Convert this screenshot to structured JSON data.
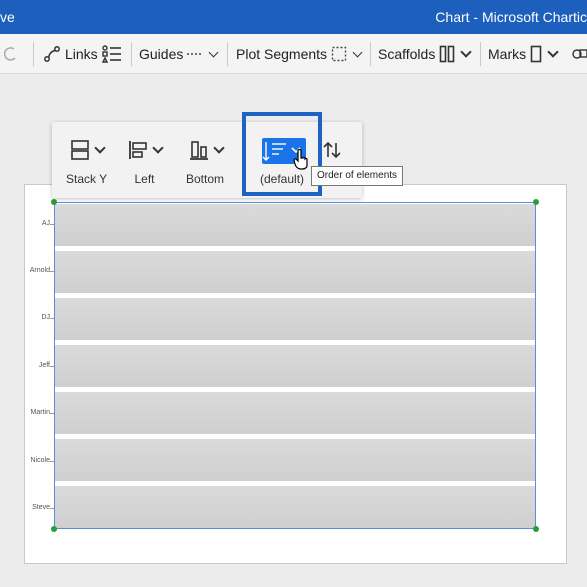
{
  "window": {
    "left_fragment": "ve",
    "title": "Chart - Microsoft Chartic"
  },
  "toolbar": {
    "links_label": "Links",
    "guides_label": "Guides",
    "plot_segments_label": "Plot Segments",
    "scaffolds_label": "Scaffolds",
    "marks_label": "Marks"
  },
  "panel": {
    "stack_label": "Stack Y",
    "align_x_label": "Left",
    "align_y_label": "Bottom",
    "order_label": "(default)"
  },
  "tooltip": {
    "text": "Order of elements"
  },
  "chart": {
    "categories": [
      "AJ",
      "Arnold",
      "DJ",
      "Jeff",
      "Martin",
      "Nicole",
      "Steve"
    ]
  },
  "colors": {
    "accent": "#1d5fbd",
    "selection": "#1e63c4",
    "handle": "#2a9d3a"
  }
}
